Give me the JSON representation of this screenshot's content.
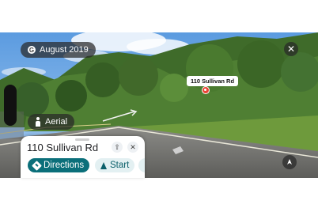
{
  "viewer": {
    "date_label": "August 2019",
    "mode_label": "Aerial",
    "close_symbol": "✕",
    "place_label": "110 Sullivan Rd"
  },
  "place_sheet": {
    "title": "110 Sullivan Rd",
    "share_symbol": "⇧",
    "close_symbol": "✕",
    "actions": [
      {
        "label": "Directions",
        "icon": "directions-icon"
      },
      {
        "label": "Start",
        "icon": "navigation-arrow-icon"
      }
    ]
  },
  "colors": {
    "accent": "#0b6f7a",
    "pin": "#ea4335"
  }
}
